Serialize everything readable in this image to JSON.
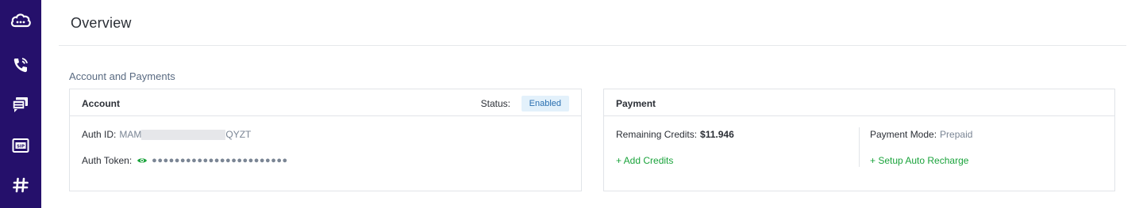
{
  "sidebar": {
    "items": [
      {
        "icon": "cloud-icon"
      },
      {
        "icon": "phone-icon"
      },
      {
        "icon": "messages-icon"
      },
      {
        "icon": "sip-icon",
        "badge": "SIP"
      },
      {
        "icon": "hashtag-icon"
      }
    ]
  },
  "page": {
    "title": "Overview"
  },
  "section": {
    "title": "Account and Payments"
  },
  "account": {
    "title": "Account",
    "status_label": "Status:",
    "status_value": "Enabled",
    "auth_id_label": "Auth ID:",
    "auth_id_prefix": "MAM",
    "auth_id_suffix": "QYZT",
    "auth_token_label": "Auth Token:",
    "auth_token_mask": "●●●●●●●●●●●●●●●●●●●●●●●●"
  },
  "payment": {
    "title": "Payment",
    "credits_label": "Remaining Credits:",
    "credits_value": "$11.946",
    "mode_label": "Payment Mode:",
    "mode_value": "Prepaid",
    "add_credits": "+ Add Credits",
    "auto_recharge": "+ Setup Auto Recharge"
  },
  "colors": {
    "sidebar_bg": "#25106b",
    "link_green": "#1aa33b",
    "badge_bg": "#e3f1fb",
    "badge_text": "#2a6fb0"
  }
}
